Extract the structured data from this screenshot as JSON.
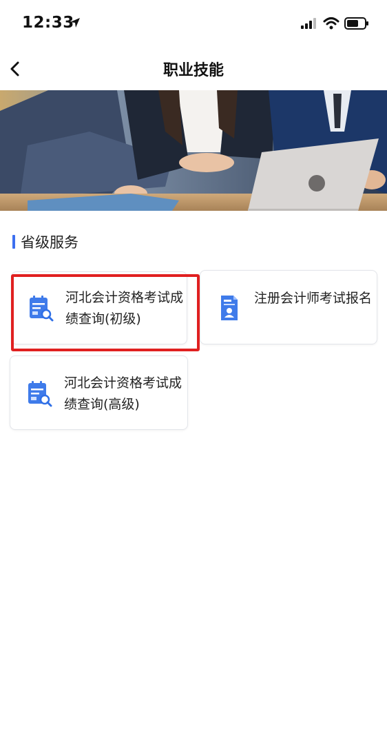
{
  "status_bar": {
    "time": "12:33"
  },
  "nav": {
    "title": "职业技能",
    "back_icon": "chevron-left-icon"
  },
  "banner": {
    "image": "office-meeting-laptop-photo"
  },
  "section": {
    "title": "省级服务"
  },
  "services": [
    {
      "label": "河北会计资格考试成绩查询(初级)",
      "icon": "score-query-icon",
      "highlighted": true
    },
    {
      "label": "注册会计师考试报名",
      "icon": "registration-form-icon",
      "highlighted": false
    },
    {
      "label": "河北会计资格考试成绩查询(高级)",
      "icon": "score-query-icon",
      "highlighted": false
    }
  ],
  "colors": {
    "accent": "#3c6ff0",
    "highlight": "#e02020",
    "icon_blue": "#2f6fe6"
  }
}
